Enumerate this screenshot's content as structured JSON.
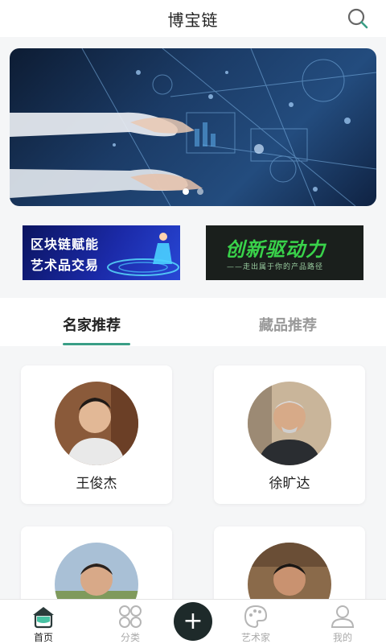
{
  "header": {
    "title": "博宝链",
    "search_icon": "search-icon"
  },
  "banner": {
    "dots": 2,
    "active_dot": 0
  },
  "promos": [
    {
      "lines": [
        "区块链赋能",
        "艺术品交易"
      ]
    },
    {
      "headline": "创新驱动力",
      "tagline": "——走出属于你的产品路径"
    }
  ],
  "tabs": [
    {
      "label": "名家推荐",
      "active": true
    },
    {
      "label": "藏品推荐",
      "active": false
    }
  ],
  "artists": [
    {
      "name": "王俊杰"
    },
    {
      "name": "徐旷达"
    },
    {
      "name": ""
    },
    {
      "name": ""
    }
  ],
  "bottom_nav": {
    "items": [
      {
        "label": "首页",
        "icon": "home-icon",
        "active": true
      },
      {
        "label": "分类",
        "icon": "grid-icon",
        "active": false
      },
      {
        "label": "+",
        "icon": "plus-icon",
        "active": false
      },
      {
        "label": "艺术家",
        "icon": "palette-icon",
        "active": false
      },
      {
        "label": "我的",
        "icon": "user-icon",
        "active": false
      }
    ]
  },
  "colors": {
    "accent": "#3a9e86",
    "dark": "#1e2a2a",
    "banner_bg": "#1b3b66"
  }
}
